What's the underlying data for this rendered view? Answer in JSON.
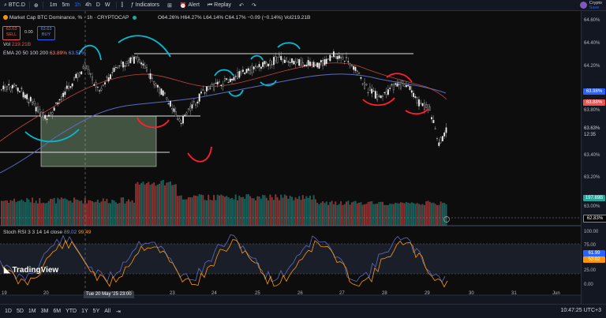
{
  "toolbar": {
    "symbol": "BTC.D",
    "timeframes": [
      "1m",
      "5m",
      "1h",
      "4h",
      "D",
      "W"
    ],
    "active_timeframe": "1h",
    "indicators": "Indicators",
    "alert": "Alert",
    "replay": "Replay",
    "brand": "Crypto",
    "brand_sub": "Save"
  },
  "legend": {
    "title": "Market Cap BTC Dominance, %",
    "interval": "1h",
    "source": "CRYPTOCAP",
    "ohlc": "O64.26% H64.27% L64.14% C64.17% −0.09 (−0.14%) Vol219.21B",
    "sell_price": "63.63",
    "sell_label": "SELL",
    "spread": "0.00",
    "buy_price": "63.63",
    "buy_label": "BUY",
    "vol": "Vol",
    "vol_value": "219.21B",
    "ema": "EMA 20 50 100 200",
    "ema_v1": "63.89%",
    "ema_v2": "63.57%",
    "stoch": "Stoch RSI 3 3 14 14 close",
    "stoch_v1": "89.02",
    "stoch_v2": "99.49"
  },
  "price_axis": {
    "ticks": [
      "64.60%",
      "64.40%",
      "64.20%",
      "63.80%",
      "63.40%",
      "63.20%",
      "63.00%"
    ],
    "last_price": "63.63%",
    "countdown": "12:35",
    "ema_label_1": "63.98%",
    "ema_label_2": "63.88%",
    "volume_label": "197.89B",
    "hline_label": "62.83%"
  },
  "rsi_axis": {
    "ticks": [
      "100.00",
      "75.00",
      "25.00",
      "0.00"
    ],
    "v1": "61.99",
    "v2": "53.02"
  },
  "x_axis": {
    "labels": [
      "19",
      "20",
      "22",
      "23",
      "24",
      "25",
      "26",
      "27",
      "28",
      "29",
      "30",
      "31",
      "Jun"
    ],
    "crosshair": "Tue 20 May '25  23:00"
  },
  "bottom": {
    "ranges": [
      "1D",
      "5D",
      "1M",
      "3M",
      "6M",
      "YTD",
      "1Y",
      "5Y",
      "All"
    ],
    "clock": "10:47:25 UTC+3"
  },
  "logo": "TradingView",
  "colors": {
    "up": "#26a69a",
    "down": "#ef5350",
    "ema": "#f28b82",
    "ema2": "#5c6bc0",
    "cyan": "#00bcd4",
    "red_mark": "#ff1f2f"
  }
}
